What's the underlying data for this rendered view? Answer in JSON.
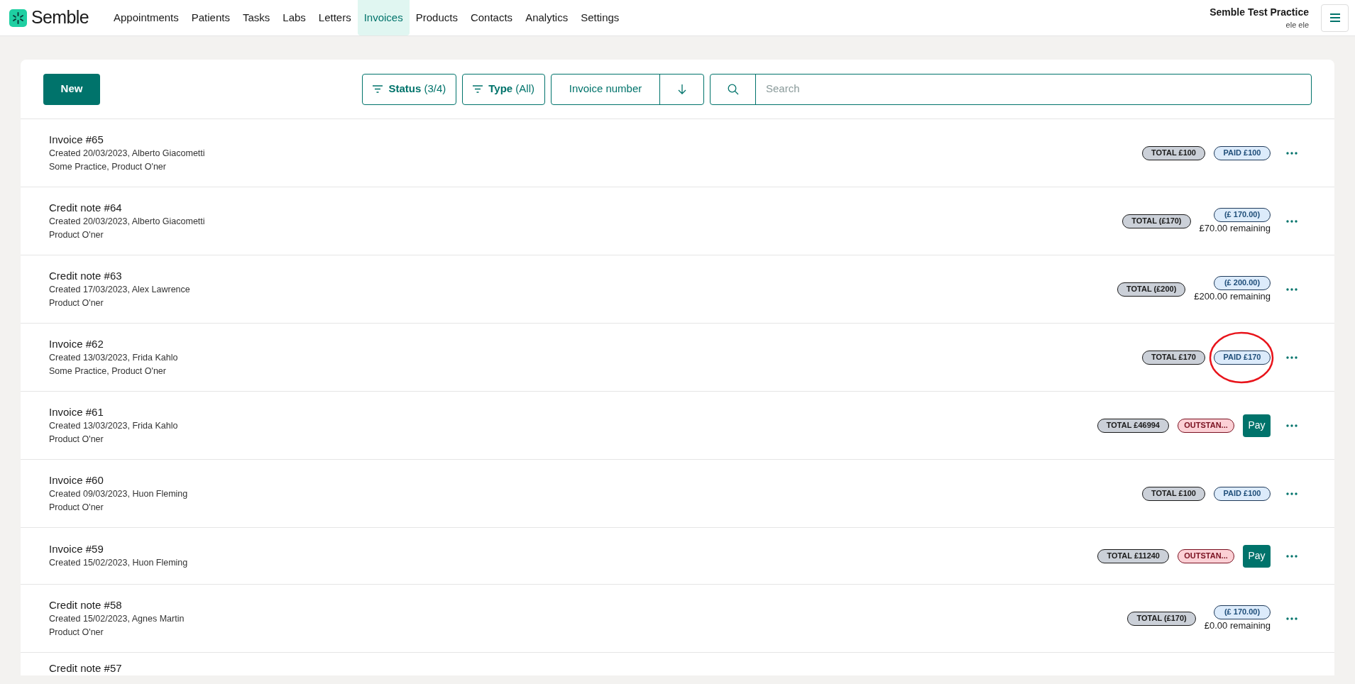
{
  "brand": {
    "name": "Semble"
  },
  "nav": [
    {
      "label": "Appointments",
      "selected": false
    },
    {
      "label": "Patients",
      "selected": false
    },
    {
      "label": "Tasks",
      "selected": false
    },
    {
      "label": "Labs",
      "selected": false
    },
    {
      "label": "Letters",
      "selected": false
    },
    {
      "label": "Invoices",
      "selected": true
    },
    {
      "label": "Products",
      "selected": false
    },
    {
      "label": "Contacts",
      "selected": false
    },
    {
      "label": "Analytics",
      "selected": false
    },
    {
      "label": "Settings",
      "selected": false
    }
  ],
  "account": {
    "practice": "Semble Test Practice",
    "user": "ele ele"
  },
  "toolbar": {
    "new_button": "New",
    "status_filter": {
      "label": "Status",
      "value": "(3/4)"
    },
    "type_filter": {
      "label": "Type",
      "value": "(All)"
    },
    "sort": {
      "label": "Invoice number"
    },
    "search": {
      "placeholder": "Search"
    }
  },
  "rows": [
    {
      "title": "Invoice #65",
      "created": "Created 20/03/2023, Alberto Giacometti",
      "detail": "Some Practice, Product O'ner",
      "total": "TOTAL £100",
      "status": {
        "kind": "paid",
        "label": "PAID £100"
      },
      "highlighted": false
    },
    {
      "title": "Credit note #64",
      "created": "Created 20/03/2023, Alberto Giacometti",
      "detail": "Product O'ner",
      "total": "TOTAL (£170)",
      "status": {
        "kind": "credit",
        "label": "(£ 170.00)",
        "remaining": "£70.00 remaining"
      },
      "highlighted": false
    },
    {
      "title": "Credit note #63",
      "created": "Created 17/03/2023, Alex Lawrence",
      "detail": "Product O'ner",
      "total": "TOTAL (£200)",
      "status": {
        "kind": "credit",
        "label": "(£ 200.00)",
        "remaining": "£200.00 remaining"
      },
      "highlighted": false
    },
    {
      "title": "Invoice #62",
      "created": "Created 13/03/2023, Frida Kahlo",
      "detail": "Some Practice, Product O'ner",
      "total": "TOTAL £170",
      "status": {
        "kind": "paid",
        "label": "PAID £170"
      },
      "highlighted": true
    },
    {
      "title": "Invoice #61",
      "created": "Created 13/03/2023, Frida Kahlo",
      "detail": "Product O'ner",
      "total": "TOTAL £46994",
      "status": {
        "kind": "outstanding",
        "label": "OUTSTAN...",
        "pay": "Pay"
      },
      "highlighted": false
    },
    {
      "title": "Invoice #60",
      "created": "Created 09/03/2023, Huon Fleming",
      "detail": "Product O'ner",
      "total": "TOTAL £100",
      "status": {
        "kind": "paid",
        "label": "PAID £100"
      },
      "highlighted": false
    },
    {
      "title": "Invoice #59",
      "created": "Created 15/02/2023, Huon Fleming",
      "total": "TOTAL £11240",
      "status": {
        "kind": "outstanding",
        "label": "OUTSTAN...",
        "pay": "Pay"
      },
      "highlighted": false
    },
    {
      "title": "Credit note #58",
      "created": "Created 15/02/2023, Agnes Martin",
      "detail": "Product O'ner",
      "total": "TOTAL (£170)",
      "status": {
        "kind": "credit",
        "label": "(£ 170.00)",
        "remaining": "£0.00 remaining"
      },
      "highlighted": false
    },
    {
      "title": "Credit note #57"
    }
  ]
}
